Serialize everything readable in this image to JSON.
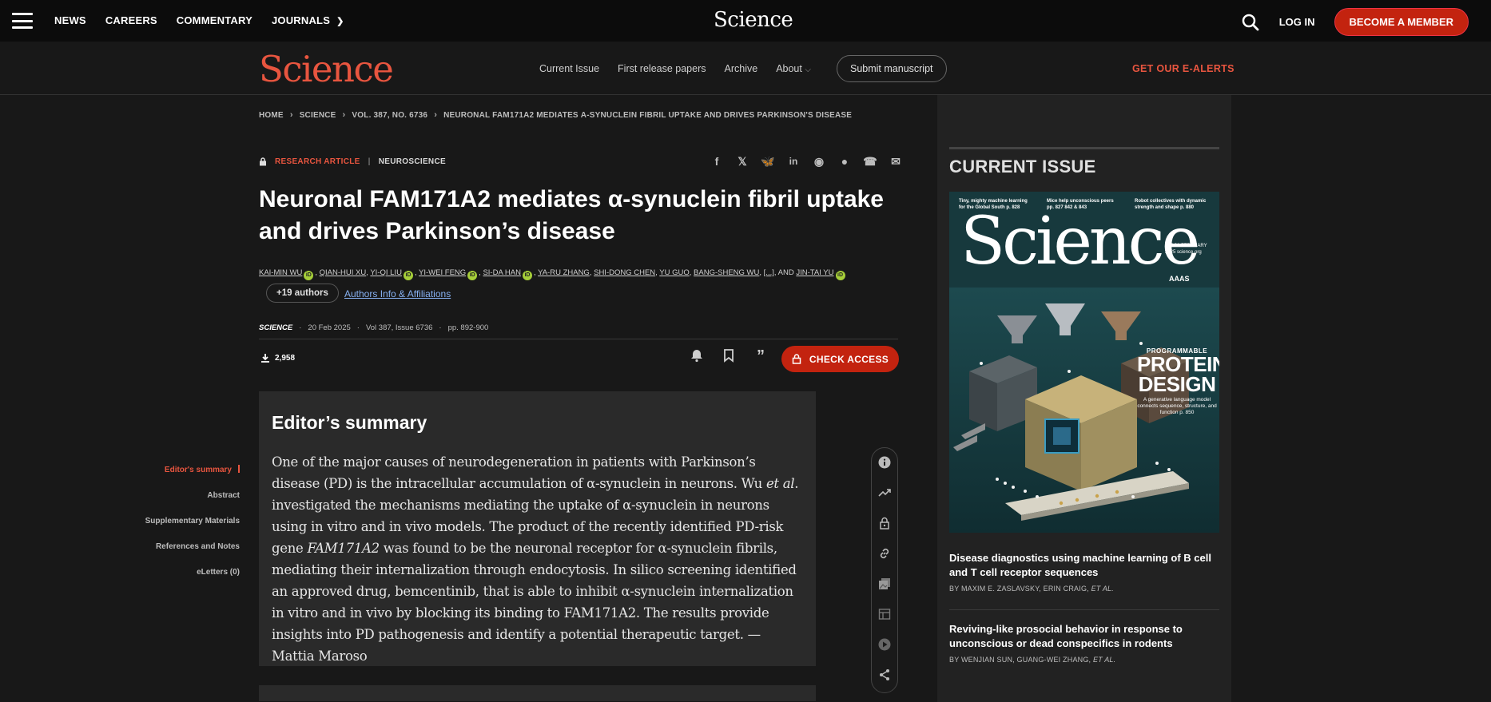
{
  "topbar": {
    "nav": [
      "NEWS",
      "CAREERS",
      "COMMENTARY",
      "JOURNALS"
    ],
    "logo": "Science",
    "login": "LOG IN",
    "member": "BECOME A MEMBER"
  },
  "subbar": {
    "logo": "Science",
    "nav": [
      "Current Issue",
      "First release papers",
      "Archive",
      "About"
    ],
    "submit": "Submit manuscript",
    "alerts": "GET OUR E-ALERTS"
  },
  "breadcrumb": [
    "HOME",
    "SCIENCE",
    "VOL. 387, NO. 6736",
    "NEURONAL FAM171A2 MEDIATES Α-SYNUCLEIN FIBRIL UPTAKE AND DRIVES PARKINSON'S DISEASE"
  ],
  "article": {
    "type": "RESEARCH ARTICLE",
    "field": "NEUROSCIENCE",
    "title": "Neuronal FAM171A2 mediates α-synuclein fibril uptake and drives Parkinson’s disease",
    "authors": [
      "KAI-MIN WU",
      "QIAN-HUI XU",
      "YI-QI LIU",
      "YI-WEI FENG",
      "SI-DA HAN",
      "YA-RU ZHANG",
      "SHI-DONG CHEN",
      "YU GUO",
      "BANG-SHENG WU",
      "[...]",
      "AND",
      "JIN-TAI YU"
    ],
    "more_authors": "+19 authors",
    "affiliations": "Authors Info & Affiliations",
    "journal": "SCIENCE",
    "date": "20 Feb 2025",
    "volume": "Vol 387, Issue 6736",
    "pages": "pp. 892-900",
    "downloads": "2,958",
    "check_access": "CHECK ACCESS"
  },
  "toc": [
    "Editor's summary",
    "Abstract",
    "Supplementary Materials",
    "References and Notes",
    "eLetters (0)"
  ],
  "summary": {
    "heading": "Editor’s summary",
    "text_1": "One of the major causes of neurodegeneration in patients with Parkinson’s disease (PD) is the intracellular accumulation of α-synuclein in neurons. Wu ",
    "text_etal": "et al",
    "text_2": ". investigated the mechanisms mediating the uptake of α-synuclein in neurons using in vitro and in vivo models. The product of the recently identified PD-risk gene ",
    "text_gene": "FAM171A2",
    "text_3": " was found to be the neuronal receptor for α-synuclein fibrils, mediating their internalization through endocytosis. In silico screening identified an approved drug, bemcentinib, that is able to inhibit α-synuclein internalization in vitro and in vivo by blocking its binding to FAM171A2. The results provide insights into PD pathogenesis and identify a potential therapeutic target. —Mattia Maroso"
  },
  "sidebar": {
    "heading": "CURRENT ISSUE",
    "cover": {
      "title": "Science",
      "head1": "Tiny, mighty machine learning for the Global South p. 828",
      "head2": "Mice help unconscious peers pp. 827 842 & 843",
      "head3": "Robot collectives with dynamic strength and shape p. 880",
      "date": "$15 21 FEBRUARY 2025 science.org",
      "aaas": "AAAS",
      "prog_small": "PROGRAMMABLE",
      "prog_big1": "PROTEIN",
      "prog_big2": "DESIGN",
      "prog_desc": "A generative language model connects sequence, structure, and function p. 850"
    },
    "stories": [
      {
        "title": "Disease diagnostics using machine learning of B cell and T cell receptor sequences",
        "by": "BY MAXIM E. ZASLAVSKY, ERIN CRAIG,",
        "etal": "ET AL."
      },
      {
        "title": "Reviving-like prosocial behavior in response to unconscious or dead conspecifics in rodents",
        "by": "BY WENJIAN SUN, GUANG-WEI ZHANG,",
        "etal": "ET AL."
      }
    ]
  }
}
